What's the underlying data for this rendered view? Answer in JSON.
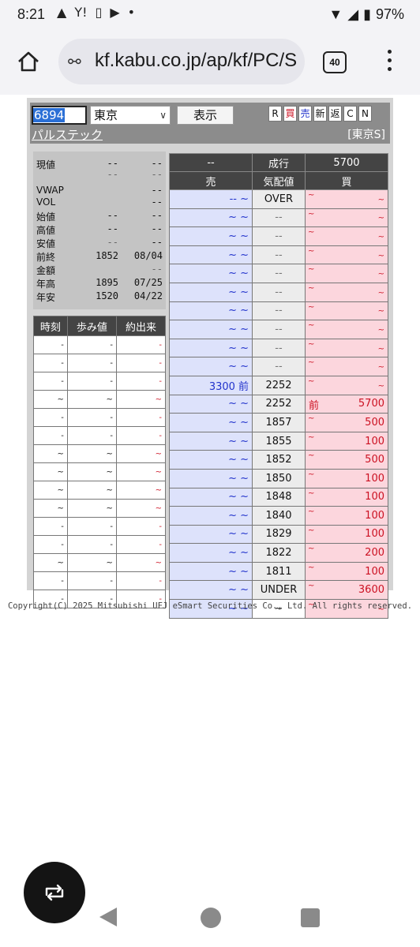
{
  "status_bar": {
    "time": "8:21",
    "battery": "97%"
  },
  "browser": {
    "url": "kf.kabu.co.jp/ap/kf/PC/S",
    "tab_count": "40"
  },
  "header": {
    "code": "6894",
    "market": "東京",
    "show_label": "表示",
    "flags": [
      "R",
      "買",
      "売",
      "新",
      "返",
      "C",
      "N"
    ],
    "stock_name": "パルステック",
    "exchange": "[東京S]"
  },
  "quote": [
    {
      "k": "現値",
      "a": "--",
      "b": "--"
    },
    {
      "k": "",
      "a": "--",
      "b": "--"
    },
    {
      "k": "VWAP",
      "a": "",
      "b": "--"
    },
    {
      "k": "VOL",
      "a": "",
      "b": "--"
    },
    {
      "k": "始値",
      "a": "--",
      "b": "--"
    },
    {
      "k": "高値",
      "a": "--",
      "b": "--"
    },
    {
      "k": "安値",
      "a": "--",
      "b": "--"
    },
    {
      "k": "前終",
      "a": "1852",
      "b": "08/04"
    },
    {
      "k": "金額",
      "a": "",
      "b": "--"
    },
    {
      "k": "年高",
      "a": "1895",
      "b": "07/25"
    },
    {
      "k": "年安",
      "a": "1520",
      "b": "04/22"
    }
  ],
  "trades": {
    "headers": [
      "時刻",
      "歩み値",
      "約出来"
    ],
    "rows": [
      [
        "-",
        "-",
        "-"
      ],
      [
        "-",
        "-",
        "-"
      ],
      [
        "-",
        "-",
        "-"
      ],
      [
        "~",
        "~",
        "~"
      ],
      [
        "-",
        "-",
        "-"
      ],
      [
        "-",
        "-",
        "-"
      ],
      [
        "~",
        "~",
        "~"
      ],
      [
        "~",
        "~",
        "~"
      ],
      [
        "~",
        "~",
        "~"
      ],
      [
        "~",
        "~",
        "~"
      ],
      [
        "-",
        "-",
        "-"
      ],
      [
        "-",
        "-",
        "-"
      ],
      [
        "~",
        "~",
        "~"
      ],
      [
        "-",
        "-",
        "-"
      ],
      [
        "-",
        "-",
        "-"
      ]
    ]
  },
  "board": {
    "top": {
      "sell": "--",
      "mid": "成行",
      "buy": "5700"
    },
    "headers": {
      "sell": "売",
      "mid": "気配値",
      "buy": "買"
    },
    "rows": [
      {
        "sell": "-- ~",
        "price": "OVER",
        "buy": "~"
      },
      {
        "sell": "~ ~",
        "price": "--",
        "buy": "~"
      },
      {
        "sell": "~ ~",
        "price": "--",
        "buy": "~"
      },
      {
        "sell": "~ ~",
        "price": "--",
        "buy": "~"
      },
      {
        "sell": "~ ~",
        "price": "--",
        "buy": "~"
      },
      {
        "sell": "~ ~",
        "price": "--",
        "buy": "~"
      },
      {
        "sell": "~ ~",
        "price": "--",
        "buy": "~"
      },
      {
        "sell": "~ ~",
        "price": "--",
        "buy": "~"
      },
      {
        "sell": "~ ~",
        "price": "--",
        "buy": "~"
      },
      {
        "sell": "~ ~",
        "price": "--",
        "buy": "~"
      },
      {
        "sell": "3300 前",
        "price": "2252",
        "buy": "~"
      },
      {
        "sell": "~ ~",
        "price": "2252",
        "buy_pre": "前",
        "buy": "5700"
      },
      {
        "sell": "~ ~",
        "price": "1857",
        "buy": "500"
      },
      {
        "sell": "~ ~",
        "price": "1855",
        "buy": "100"
      },
      {
        "sell": "~ ~",
        "price": "1852",
        "buy": "500"
      },
      {
        "sell": "~ ~",
        "price": "1850",
        "buy": "100"
      },
      {
        "sell": "~ ~",
        "price": "1848",
        "buy": "100"
      },
      {
        "sell": "~ ~",
        "price": "1840",
        "buy": "100"
      },
      {
        "sell": "~ ~",
        "price": "1829",
        "buy": "100"
      },
      {
        "sell": "~ ~",
        "price": "1822",
        "buy": "200"
      },
      {
        "sell": "~ ~",
        "price": "1811",
        "buy": "100"
      },
      {
        "sell": "~ ~",
        "price": "UNDER",
        "buy": "3600"
      },
      {
        "sell": "~ ~",
        "price": "~",
        "buy": "~"
      }
    ]
  },
  "footer": {
    "copyright": "Copyright(C) 2025 Mitsubishi UFJ eSmart Securities Co., Ltd. All rights reserved."
  }
}
